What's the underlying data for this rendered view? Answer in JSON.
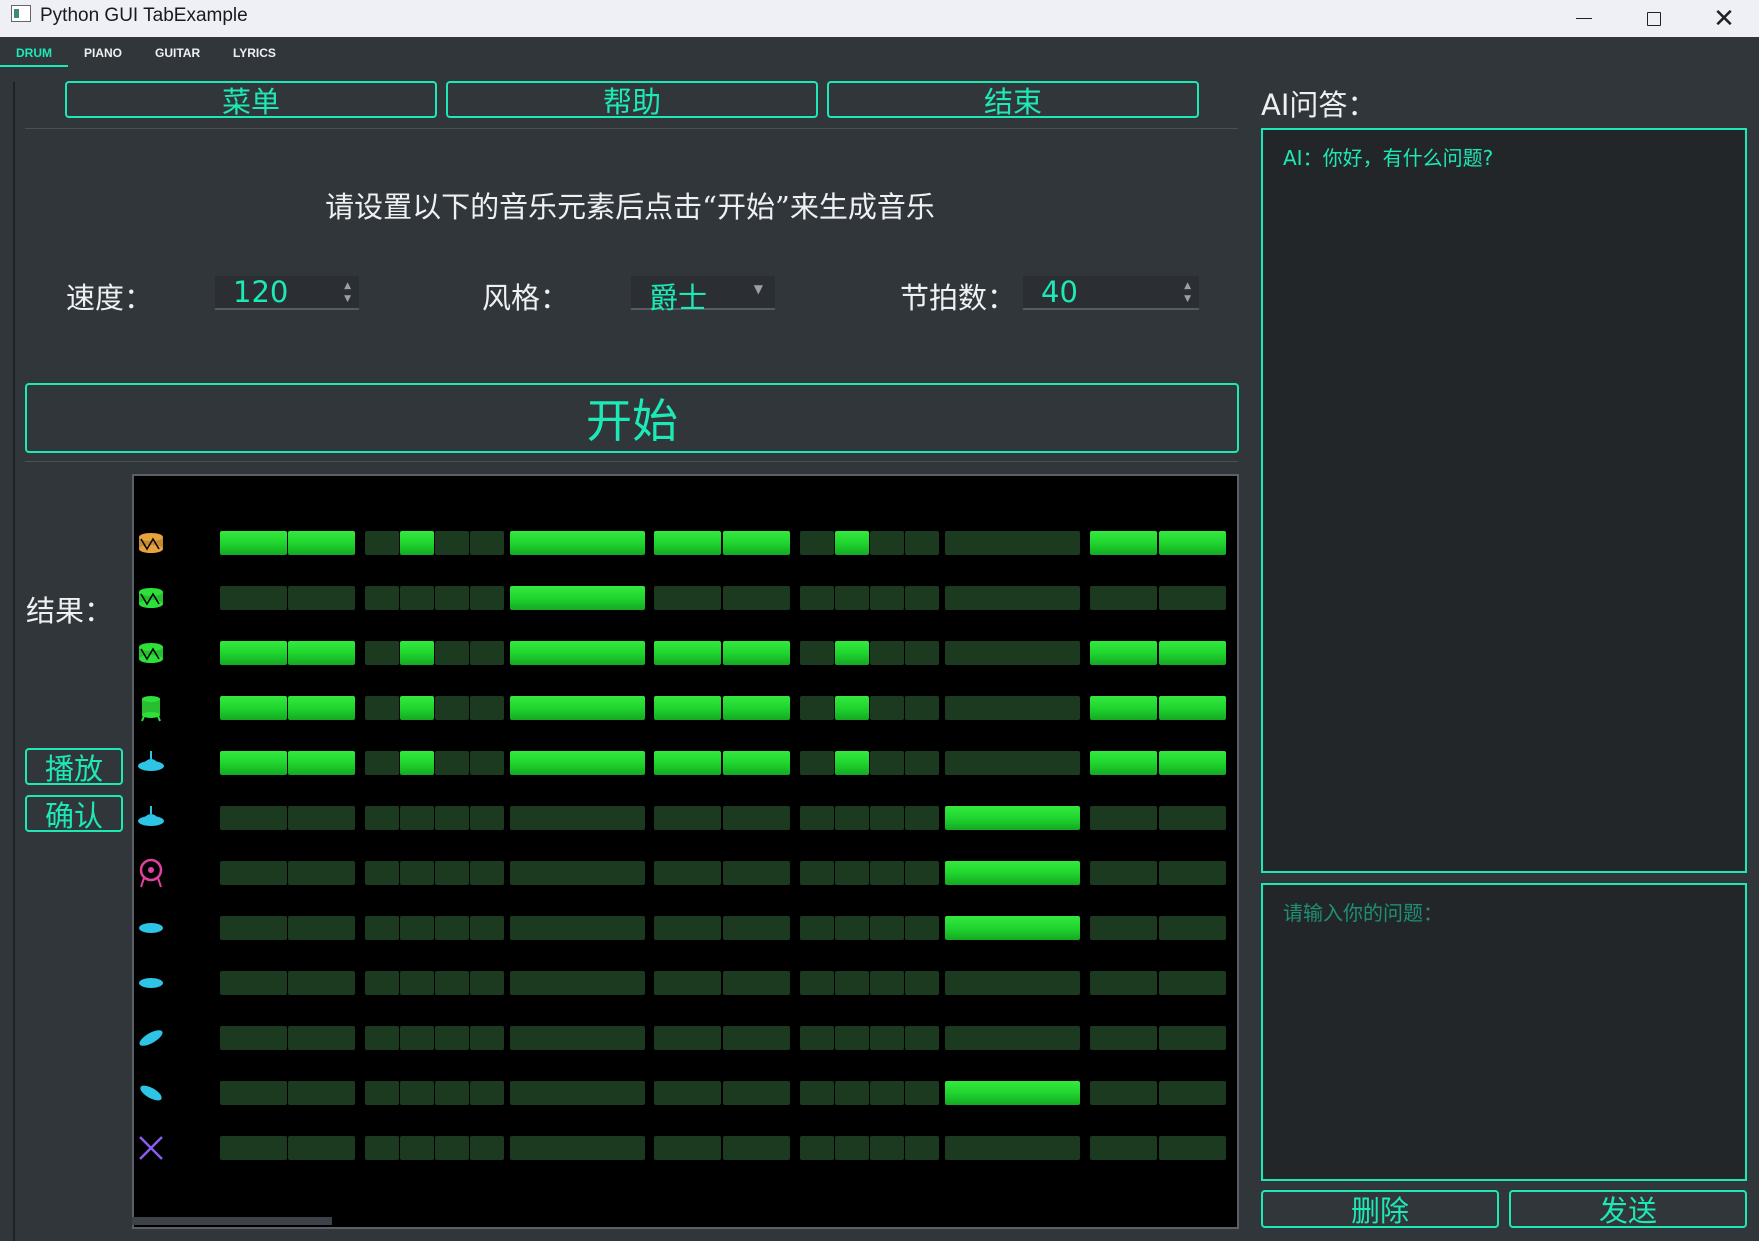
{
  "window": {
    "title": "Python GUI TabExample",
    "close_glyph": "✕"
  },
  "tabs": [
    {
      "label": "DRUM",
      "active": true
    },
    {
      "label": "PIANO",
      "active": false
    },
    {
      "label": "GUITAR",
      "active": false
    },
    {
      "label": "LYRICS",
      "active": false
    }
  ],
  "toolbar": {
    "menu": "菜单",
    "help": "帮助",
    "exit": "结束"
  },
  "instruction": "请设置以下的音乐元素后点击“开始”来生成音乐",
  "settings": {
    "tempo": {
      "label": "速度：",
      "value": "120"
    },
    "style": {
      "label": "风格：",
      "value": "爵士"
    },
    "beats": {
      "label": "节拍数：",
      "value": "40"
    }
  },
  "start_button": "开始",
  "result": {
    "label": "结果：",
    "play": "播放",
    "confirm": "确认"
  },
  "sequencer": {
    "instruments": [
      {
        "icon": "snare-drum-icon",
        "color": "#e6a23c",
        "steps": [
          1,
          1,
          0,
          1,
          0,
          0,
          1,
          1,
          1,
          0,
          1,
          0,
          0,
          0,
          1,
          1
        ]
      },
      {
        "icon": "tom-drum-icon",
        "color": "#2ee03a",
        "steps": [
          0,
          0,
          0,
          0,
          0,
          0,
          1,
          0,
          0,
          0,
          0,
          0,
          0,
          0,
          0,
          0
        ]
      },
      {
        "icon": "tom-drum-icon",
        "color": "#2ee03a",
        "steps": [
          1,
          1,
          0,
          1,
          0,
          0,
          1,
          1,
          1,
          0,
          1,
          0,
          0,
          0,
          1,
          1
        ]
      },
      {
        "icon": "floor-tom-icon",
        "color": "#2ee03a",
        "steps": [
          1,
          1,
          0,
          1,
          0,
          0,
          1,
          1,
          1,
          0,
          1,
          0,
          0,
          0,
          1,
          1
        ]
      },
      {
        "icon": "hihat-icon",
        "color": "#2ec4e6",
        "steps": [
          1,
          1,
          0,
          1,
          0,
          0,
          1,
          1,
          1,
          0,
          1,
          0,
          0,
          0,
          1,
          1
        ]
      },
      {
        "icon": "hihat-icon",
        "color": "#2ec4e6",
        "steps": [
          0,
          0,
          0,
          0,
          0,
          0,
          0,
          0,
          0,
          0,
          0,
          0,
          0,
          1,
          0,
          0
        ]
      },
      {
        "icon": "gong-icon",
        "color": "#e040a0",
        "steps": [
          0,
          0,
          0,
          0,
          0,
          0,
          0,
          0,
          0,
          0,
          0,
          0,
          0,
          1,
          0,
          0
        ]
      },
      {
        "icon": "cymbal-icon",
        "color": "#2ec4e6",
        "steps": [
          0,
          0,
          0,
          0,
          0,
          0,
          0,
          0,
          0,
          0,
          0,
          0,
          0,
          1,
          0,
          0
        ]
      },
      {
        "icon": "cymbal-icon",
        "color": "#2ec4e6",
        "steps": [
          0,
          0,
          0,
          0,
          0,
          0,
          0,
          0,
          0,
          0,
          0,
          0,
          0,
          0,
          0,
          0
        ]
      },
      {
        "icon": "crash-cymbal-icon",
        "color": "#2ec4e6",
        "steps": [
          0,
          0,
          0,
          0,
          0,
          0,
          0,
          0,
          0,
          0,
          0,
          0,
          0,
          0,
          0,
          0
        ]
      },
      {
        "icon": "splash-cymbal-icon",
        "color": "#2ec4e6",
        "steps": [
          0,
          0,
          0,
          0,
          0,
          0,
          0,
          0,
          0,
          0,
          0,
          0,
          0,
          1,
          0,
          0
        ]
      },
      {
        "icon": "drumsticks-icon",
        "color": "#8a5cf0",
        "steps": [
          0,
          0,
          0,
          0,
          0,
          0,
          0,
          0,
          0,
          0,
          0,
          0,
          0,
          0,
          0,
          0
        ]
      }
    ]
  },
  "ai": {
    "title": "AI问答：",
    "message": "AI：你好，有什么问题?",
    "input_placeholder": "请输入你的问题：",
    "delete": "删除",
    "send": "发送"
  },
  "colors": {
    "accent": "#1de9b6",
    "background": "#31363b",
    "cell_on": "#1fd62e",
    "cell_off": "#1c3a1f"
  }
}
